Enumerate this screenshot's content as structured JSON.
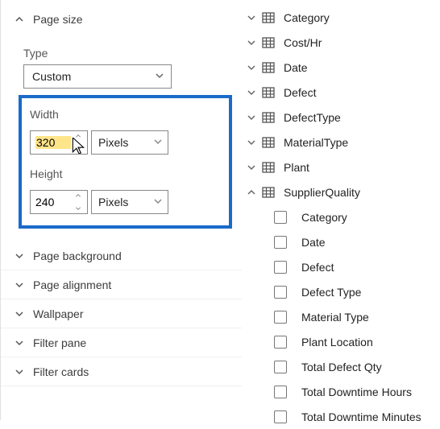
{
  "left": {
    "page_size": {
      "title": "Page size",
      "type_label": "Type",
      "type_value": "Custom",
      "width_label": "Width",
      "width_value": "320",
      "width_unit": "Pixels",
      "height_label": "Height",
      "height_value": "240",
      "height_unit": "Pixels"
    },
    "sections": [
      "Page background",
      "Page alignment",
      "Wallpaper",
      "Filter pane",
      "Filter cards"
    ]
  },
  "right": {
    "tables": [
      {
        "name": "Category",
        "expanded": false
      },
      {
        "name": "Cost/Hr",
        "expanded": false
      },
      {
        "name": "Date",
        "expanded": false
      },
      {
        "name": "Defect",
        "expanded": false
      },
      {
        "name": "DefectType",
        "expanded": false
      },
      {
        "name": "MaterialType",
        "expanded": false
      },
      {
        "name": "Plant",
        "expanded": false
      },
      {
        "name": "SupplierQuality",
        "expanded": true
      }
    ],
    "supplier_quality_fields": [
      "Category",
      "Date",
      "Defect",
      "Defect Type",
      "Material Type",
      "Plant Location",
      "Total Defect Qty",
      "Total Downtime Hours",
      "Total Downtime Minutes"
    ]
  }
}
